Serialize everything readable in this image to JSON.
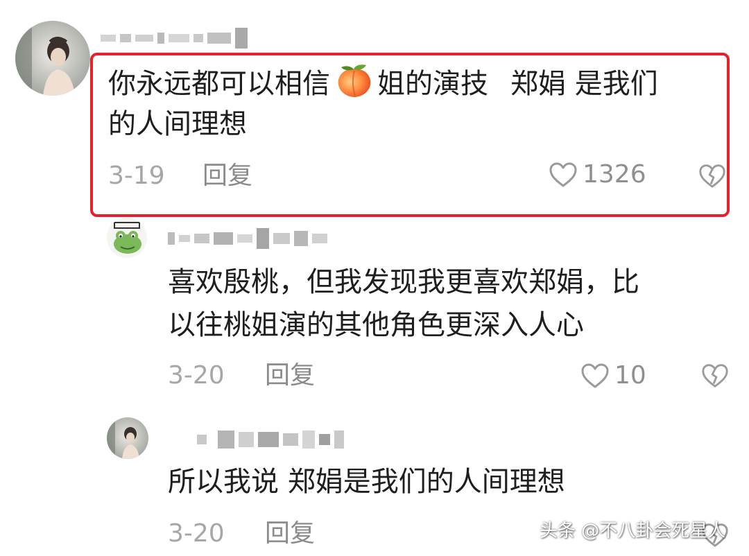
{
  "comments": [
    {
      "text_line1_a": "你永远都可以相信",
      "emoji": "peach-emoji",
      "text_line1_b": "姐的演技",
      "text_line1_c": "郑娟 是我们",
      "text_line2": "的人间理想",
      "date": "3-19",
      "reply_label": "回复",
      "likes": "1326",
      "highlighted": true
    },
    {
      "text_line1": "喜欢殷桃，但我发现我更喜欢郑娟，比",
      "text_line2": "以往桃姐演的其他角色更深入人心",
      "date": "3-20",
      "reply_label": "回复",
      "likes": "10"
    },
    {
      "text_line1": "所以我说 郑娟是我们的人间理想",
      "date": "3-20",
      "reply_label": "回复"
    }
  ],
  "watermark": "头条 @不八卦会死星人",
  "colors": {
    "highlight_border": "#e8202a",
    "text": "#1e1e1e",
    "meta": "#a6a6a6",
    "icon": "#9a9a9a"
  },
  "icons": [
    "heart-outline-icon",
    "broken-heart-icon",
    "peach-emoji"
  ]
}
